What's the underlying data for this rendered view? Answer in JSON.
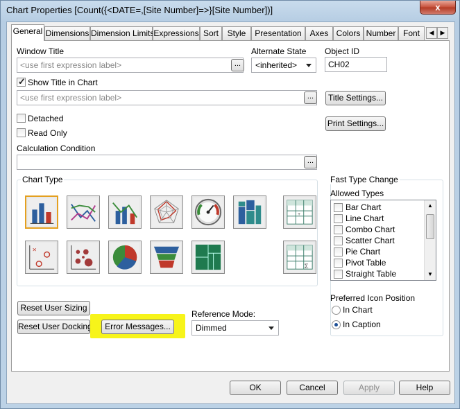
{
  "window": {
    "title": "Chart Properties [Count({<DATE=,[Site Number]=>}[Site Number])]",
    "close_label": "x"
  },
  "tabs": [
    "General",
    "Dimensions",
    "Dimension Limits",
    "Expressions",
    "Sort",
    "Style",
    "Presentation",
    "Axes",
    "Colors",
    "Number",
    "Font"
  ],
  "tab_scroll": {
    "left": "◀",
    "right": "▶"
  },
  "general": {
    "window_title_label": "Window Title",
    "window_title_placeholder": "<use first expression label>",
    "browse_label": "...",
    "alternate_state_label": "Alternate State",
    "alternate_state_value": "<inherited>",
    "object_id_label": "Object ID",
    "object_id_value": "CH02",
    "show_title_label": "Show Title in Chart",
    "show_title_checked": true,
    "title_placeholder": "<use first expression label>",
    "title_settings_label": "Title Settings...",
    "print_settings_label": "Print Settings...",
    "detached_label": "Detached",
    "read_only_label": "Read Only",
    "calc_condition_label": "Calculation Condition",
    "calc_condition_value": "",
    "chart_type_label": "Chart Type",
    "chart_types": [
      "bar",
      "line",
      "combo",
      "radar",
      "gauge",
      "mekko",
      "pivot-table",
      "scatter",
      "grid",
      "pie",
      "funnel",
      "block",
      "straight-table"
    ],
    "fast_type_label": "Fast Type Change",
    "allowed_types_label": "Allowed Types",
    "allowed_types": [
      "Bar Chart",
      "Line Chart",
      "Combo Chart",
      "Scatter Chart",
      "Pie Chart",
      "Pivot Table",
      "Straight Table"
    ],
    "preferred_icon_label": "Preferred Icon Position",
    "in_chart_label": "In Chart",
    "in_caption_label": "In Caption",
    "reset_sizing_label": "Reset User Sizing",
    "reset_docking_label": "Reset User Docking",
    "error_messages_label": "Error Messages...",
    "reference_mode_label": "Reference Mode:",
    "reference_mode_value": "Dimmed"
  },
  "footer": {
    "ok_label": "OK",
    "cancel_label": "Cancel",
    "apply_label": "Apply",
    "help_label": "Help"
  },
  "colors": {
    "highlight": "#f7f41a",
    "selected_border": "#e4a020"
  }
}
